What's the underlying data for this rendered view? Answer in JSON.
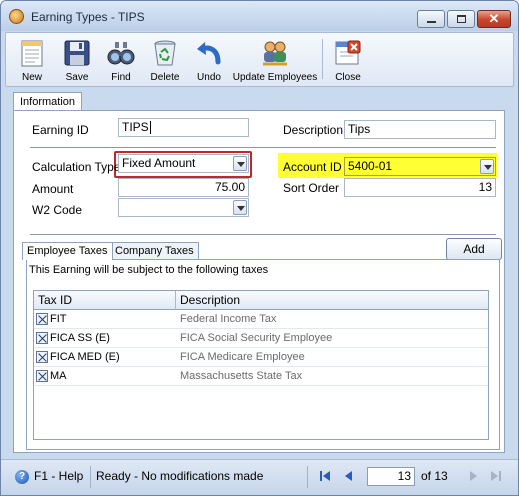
{
  "window": {
    "title": "Earning Types - TIPS"
  },
  "toolbar": {
    "new": "New",
    "save": "Save",
    "find": "Find",
    "delete": "Delete",
    "undo": "Undo",
    "update_employees": "Update Employees",
    "close": "Close"
  },
  "tabs": {
    "information": "Information"
  },
  "form": {
    "earning_id_label": "Earning ID",
    "earning_id_value": "TIPS",
    "description_label": "Description",
    "description_value": "Tips",
    "calc_type_label": "Calculation Type",
    "calc_type_value": "Fixed Amount",
    "account_id_label": "Account ID",
    "account_id_value": "5400-01",
    "amount_label": "Amount",
    "amount_value": "75.00",
    "sort_order_label": "Sort Order",
    "sort_order_value": "13",
    "w2_code_label": "W2 Code",
    "w2_code_value": ""
  },
  "subtabs": {
    "employee_taxes": "Employee Taxes",
    "company_taxes": "Company Taxes",
    "add": "Add"
  },
  "taxes": {
    "intro": "This Earning will be subject to the following taxes",
    "col_tax_id": "Tax ID",
    "col_description": "Description",
    "rows": [
      {
        "tax_id": "FIT",
        "description": "Federal Income Tax",
        "checked": true
      },
      {
        "tax_id": "FICA SS (E)",
        "description": "FICA Social Security Employee",
        "checked": true
      },
      {
        "tax_id": "FICA MED (E)",
        "description": "FICA Medicare Employee",
        "checked": true
      },
      {
        "tax_id": "MA",
        "description": "Massachusetts State Tax",
        "checked": true
      }
    ]
  },
  "status": {
    "help": "F1 - Help",
    "message": "Ready - No modifications made",
    "page_current": "13",
    "page_of": "of 13"
  },
  "colors": {
    "highlight_red": "#c4262c",
    "highlight_yellow": "#ffff33",
    "chrome_blue": "#c9daee"
  }
}
